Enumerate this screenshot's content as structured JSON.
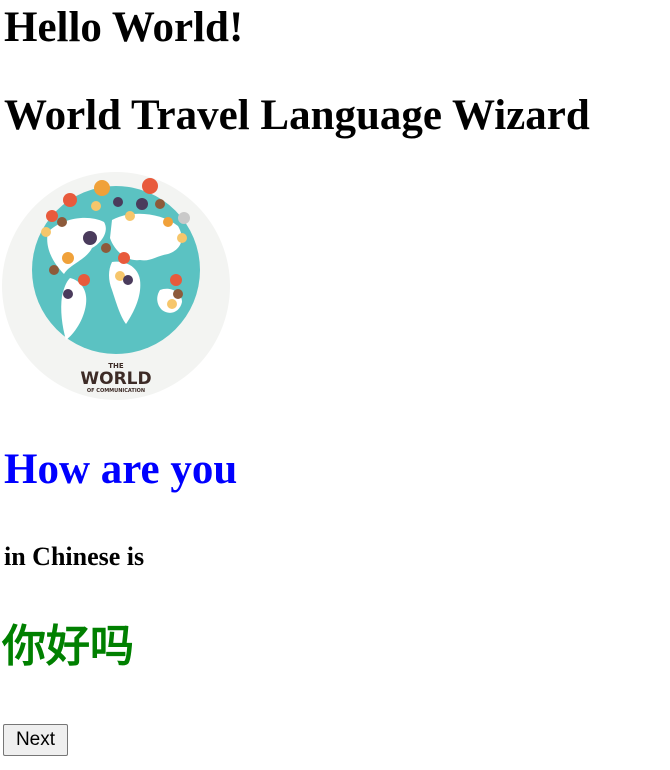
{
  "page": {
    "greeting": "Hello World!",
    "app_title": "World Travel Language Wizard"
  },
  "logo": {
    "icon_name": "world-communication-globe",
    "line1": "THE",
    "line2": "WORLD",
    "line3": "OF COMMUNICATION"
  },
  "lesson": {
    "phrase": "How are you",
    "phrase_color": "#0000ff",
    "connector": "in Chinese is",
    "translation": "你好吗",
    "translation_color": "#008000"
  },
  "controls": {
    "next_label": "Next"
  }
}
